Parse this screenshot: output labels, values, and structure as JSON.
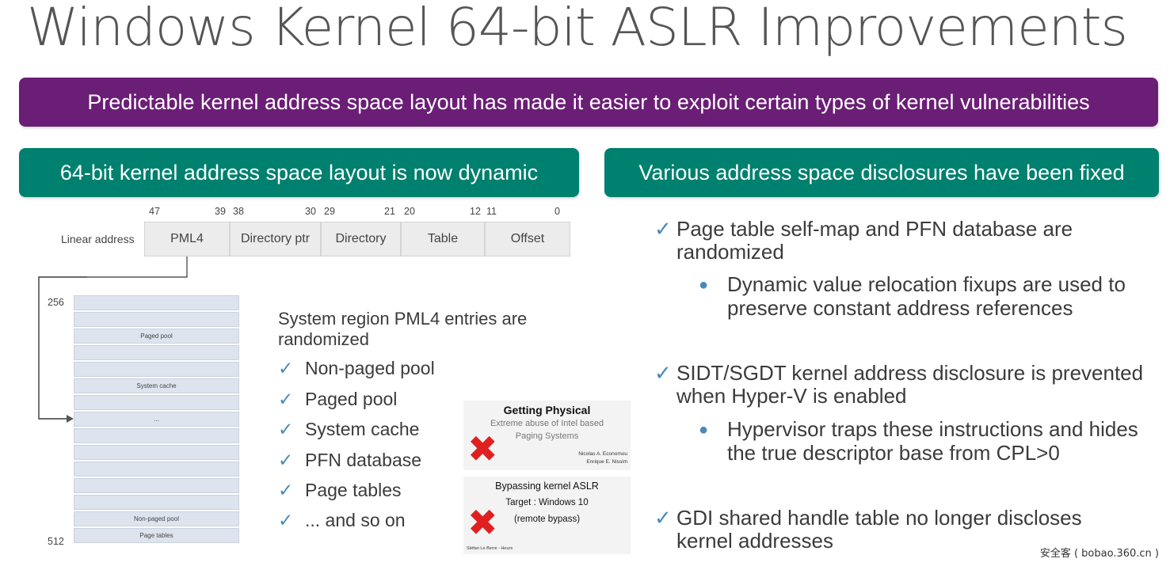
{
  "slide": {
    "title": "Windows Kernel 64-bit ASLR Improvements",
    "banner": "Predictable kernel address space layout has made it easier to exploit certain types of kernel vulnerabilities",
    "left_heading": "64-bit kernel address space layout is now dynamic",
    "right_heading": "Various address space disclosures have been fixed"
  },
  "address_diagram": {
    "row_label": "Linear address",
    "bit_numbers": [
      "47",
      "39",
      "38",
      "30",
      "29",
      "21",
      "20",
      "12",
      "11",
      "0"
    ],
    "fields": [
      "PML4",
      "Directory ptr",
      "Directory",
      "Table",
      "Offset"
    ]
  },
  "pml4_table": {
    "top_label": "256",
    "bottom_label": "512",
    "rows": [
      "",
      "",
      "Paged pool",
      "",
      "",
      "System cache",
      "",
      "...",
      "",
      "",
      "",
      "",
      "",
      "Non-paged pool",
      "Page tables"
    ]
  },
  "middle_list": {
    "heading_line1": "System region PML4 entries are",
    "heading_line2": "randomized",
    "items": [
      "Non-paged pool",
      "Paged pool",
      "System cache",
      "PFN database",
      "Page tables",
      "... and so on"
    ]
  },
  "papers": {
    "paper1_title": "Getting Physical",
    "paper1_subtitle1": "Extreme abuse of Intel based",
    "paper1_subtitle2": "Paging Systems",
    "paper1_author1": "Nicolas A. Economou",
    "paper1_author2": "Enrique E. Nissim",
    "paper2_title": "Bypassing kernel ASLR",
    "paper2_target": "Target : Windows 10",
    "paper2_note": "(remote bypass)",
    "paper2_author": "Stéfan Le Berre - Heurs"
  },
  "right_list": {
    "item1_line1": "Page table self-map and PFN database are",
    "item1_line2": "randomized",
    "sub1_line1": "Dynamic value relocation fixups are used to",
    "sub1_line2": "preserve constant address references",
    "item2_line1": "SIDT/SGDT kernel address disclosure is prevented",
    "item2_line2": "when Hyper-V is enabled",
    "sub2_line1": "Hypervisor traps these instructions and hides",
    "sub2_line2": "the true descriptor base from CPL>0",
    "item3_line1": "GDI shared handle table no longer discloses",
    "item3_line2": "kernel addresses"
  },
  "watermark": "安全客 ( bobao.360.cn )",
  "icons": {
    "check": "check-icon",
    "bullet": "bullet-dot-icon",
    "cross": "red-x-icon"
  },
  "colors": {
    "purple_banner": "#6b1e76",
    "teal_banner": "#00806e",
    "check_blue": "#4a89b8",
    "red_x": "#e02020"
  }
}
